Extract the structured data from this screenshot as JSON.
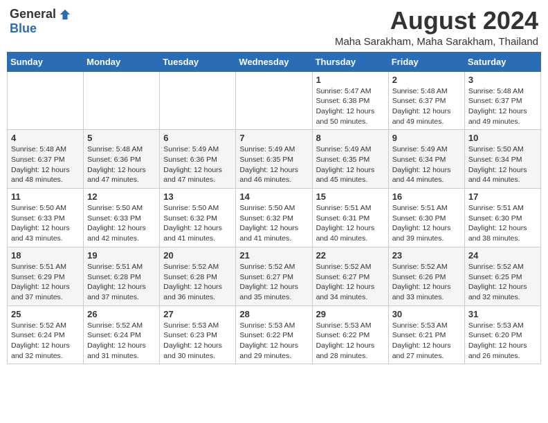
{
  "logo": {
    "general": "General",
    "blue": "Blue"
  },
  "header": {
    "title": "August 2024",
    "subtitle": "Maha Sarakham, Maha Sarakham, Thailand"
  },
  "weekdays": [
    "Sunday",
    "Monday",
    "Tuesday",
    "Wednesday",
    "Thursday",
    "Friday",
    "Saturday"
  ],
  "weeks": [
    [
      {
        "day": "",
        "info": ""
      },
      {
        "day": "",
        "info": ""
      },
      {
        "day": "",
        "info": ""
      },
      {
        "day": "",
        "info": ""
      },
      {
        "day": "1",
        "info": "Sunrise: 5:47 AM\nSunset: 6:38 PM\nDaylight: 12 hours\nand 50 minutes."
      },
      {
        "day": "2",
        "info": "Sunrise: 5:48 AM\nSunset: 6:37 PM\nDaylight: 12 hours\nand 49 minutes."
      },
      {
        "day": "3",
        "info": "Sunrise: 5:48 AM\nSunset: 6:37 PM\nDaylight: 12 hours\nand 49 minutes."
      }
    ],
    [
      {
        "day": "4",
        "info": "Sunrise: 5:48 AM\nSunset: 6:37 PM\nDaylight: 12 hours\nand 48 minutes."
      },
      {
        "day": "5",
        "info": "Sunrise: 5:48 AM\nSunset: 6:36 PM\nDaylight: 12 hours\nand 47 minutes."
      },
      {
        "day": "6",
        "info": "Sunrise: 5:49 AM\nSunset: 6:36 PM\nDaylight: 12 hours\nand 47 minutes."
      },
      {
        "day": "7",
        "info": "Sunrise: 5:49 AM\nSunset: 6:35 PM\nDaylight: 12 hours\nand 46 minutes."
      },
      {
        "day": "8",
        "info": "Sunrise: 5:49 AM\nSunset: 6:35 PM\nDaylight: 12 hours\nand 45 minutes."
      },
      {
        "day": "9",
        "info": "Sunrise: 5:49 AM\nSunset: 6:34 PM\nDaylight: 12 hours\nand 44 minutes."
      },
      {
        "day": "10",
        "info": "Sunrise: 5:50 AM\nSunset: 6:34 PM\nDaylight: 12 hours\nand 44 minutes."
      }
    ],
    [
      {
        "day": "11",
        "info": "Sunrise: 5:50 AM\nSunset: 6:33 PM\nDaylight: 12 hours\nand 43 minutes."
      },
      {
        "day": "12",
        "info": "Sunrise: 5:50 AM\nSunset: 6:33 PM\nDaylight: 12 hours\nand 42 minutes."
      },
      {
        "day": "13",
        "info": "Sunrise: 5:50 AM\nSunset: 6:32 PM\nDaylight: 12 hours\nand 41 minutes."
      },
      {
        "day": "14",
        "info": "Sunrise: 5:50 AM\nSunset: 6:32 PM\nDaylight: 12 hours\nand 41 minutes."
      },
      {
        "day": "15",
        "info": "Sunrise: 5:51 AM\nSunset: 6:31 PM\nDaylight: 12 hours\nand 40 minutes."
      },
      {
        "day": "16",
        "info": "Sunrise: 5:51 AM\nSunset: 6:30 PM\nDaylight: 12 hours\nand 39 minutes."
      },
      {
        "day": "17",
        "info": "Sunrise: 5:51 AM\nSunset: 6:30 PM\nDaylight: 12 hours\nand 38 minutes."
      }
    ],
    [
      {
        "day": "18",
        "info": "Sunrise: 5:51 AM\nSunset: 6:29 PM\nDaylight: 12 hours\nand 37 minutes."
      },
      {
        "day": "19",
        "info": "Sunrise: 5:51 AM\nSunset: 6:28 PM\nDaylight: 12 hours\nand 37 minutes."
      },
      {
        "day": "20",
        "info": "Sunrise: 5:52 AM\nSunset: 6:28 PM\nDaylight: 12 hours\nand 36 minutes."
      },
      {
        "day": "21",
        "info": "Sunrise: 5:52 AM\nSunset: 6:27 PM\nDaylight: 12 hours\nand 35 minutes."
      },
      {
        "day": "22",
        "info": "Sunrise: 5:52 AM\nSunset: 6:27 PM\nDaylight: 12 hours\nand 34 minutes."
      },
      {
        "day": "23",
        "info": "Sunrise: 5:52 AM\nSunset: 6:26 PM\nDaylight: 12 hours\nand 33 minutes."
      },
      {
        "day": "24",
        "info": "Sunrise: 5:52 AM\nSunset: 6:25 PM\nDaylight: 12 hours\nand 32 minutes."
      }
    ],
    [
      {
        "day": "25",
        "info": "Sunrise: 5:52 AM\nSunset: 6:24 PM\nDaylight: 12 hours\nand 32 minutes."
      },
      {
        "day": "26",
        "info": "Sunrise: 5:52 AM\nSunset: 6:24 PM\nDaylight: 12 hours\nand 31 minutes."
      },
      {
        "day": "27",
        "info": "Sunrise: 5:53 AM\nSunset: 6:23 PM\nDaylight: 12 hours\nand 30 minutes."
      },
      {
        "day": "28",
        "info": "Sunrise: 5:53 AM\nSunset: 6:22 PM\nDaylight: 12 hours\nand 29 minutes."
      },
      {
        "day": "29",
        "info": "Sunrise: 5:53 AM\nSunset: 6:22 PM\nDaylight: 12 hours\nand 28 minutes."
      },
      {
        "day": "30",
        "info": "Sunrise: 5:53 AM\nSunset: 6:21 PM\nDaylight: 12 hours\nand 27 minutes."
      },
      {
        "day": "31",
        "info": "Sunrise: 5:53 AM\nSunset: 6:20 PM\nDaylight: 12 hours\nand 26 minutes."
      }
    ]
  ]
}
